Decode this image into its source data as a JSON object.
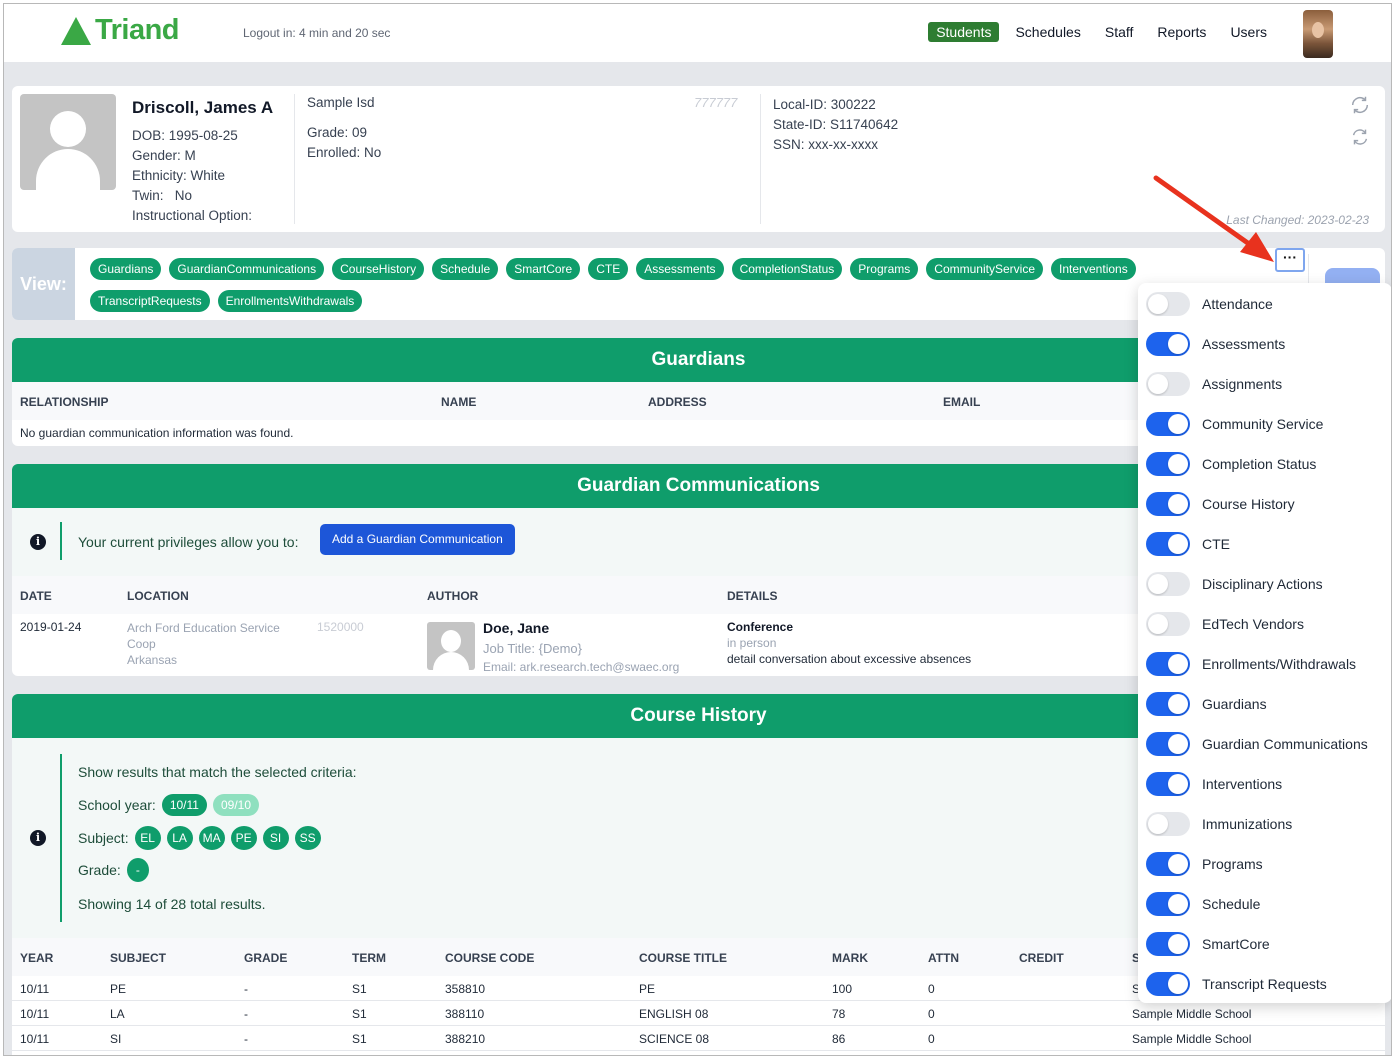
{
  "header": {
    "logo_text": "Triand",
    "logout_text": "Logout in: 4 min and 20 sec",
    "nav": [
      {
        "label": "Students",
        "active": true
      },
      {
        "label": "Schedules",
        "active": false
      },
      {
        "label": "Staff",
        "active": false
      },
      {
        "label": "Reports",
        "active": false
      },
      {
        "label": "Users",
        "active": false
      }
    ]
  },
  "student": {
    "name": "Driscoll, James A",
    "dob": "DOB: 1995-08-25",
    "gender": "Gender: M",
    "ethnicity": "Ethnicity: White",
    "twin": "Twin:   No",
    "instructional_option": "Instructional Option:",
    "district": "Sample Isd",
    "district_code": "777777",
    "grade": "Grade: 09",
    "enrolled": "Enrolled: No",
    "local_id": "Local-ID: 300222",
    "state_id": "State-ID: S11740642",
    "ssn": "SSN: xxx-xx-xxxx",
    "last_changed": "Last Changed: 2023-02-23"
  },
  "view": {
    "label": "View:",
    "pills": [
      "Guardians",
      "GuardianCommunications",
      "CourseHistory",
      "Schedule",
      "SmartCore",
      "CTE",
      "Assessments",
      "CompletionStatus",
      "Programs",
      "CommunityService",
      "Interventions",
      "TranscriptRequests",
      "EnrollmentsWithdrawals"
    ],
    "more_label": "···"
  },
  "guardians": {
    "title": "Guardians",
    "columns": [
      "RELATIONSHIP",
      "NAME",
      "ADDRESS",
      "EMAIL"
    ],
    "empty_message": "No guardian communication information was found."
  },
  "guardian_comms": {
    "title": "Guardian Communications",
    "privileges_text": "Your current privileges allow you to:",
    "add_button": "Add a Guardian Communication",
    "columns": [
      "DATE",
      "LOCATION",
      "AUTHOR",
      "DETAILS"
    ],
    "rows": [
      {
        "date": "2019-01-24",
        "location": "Arch Ford Education Service Coop",
        "location_state": "Arkansas",
        "location_code": "1520000",
        "author_name": "Doe, Jane",
        "author_job": "Job Title: {Demo}",
        "author_email": "Email: ark.research.tech@swaec.org",
        "detail_type": "Conference",
        "detail_mode": "in person",
        "detail_text": "detail conversation about excessive absences"
      }
    ]
  },
  "course_history": {
    "title": "Course History",
    "criteria_title": "Show results that match the selected criteria:",
    "school_year_label": "School year:",
    "school_years": [
      {
        "label": "10/11",
        "selected": true
      },
      {
        "label": "09/10",
        "selected": false
      }
    ],
    "subject_label": "Subject:",
    "subjects": [
      "EL",
      "LA",
      "MA",
      "PE",
      "SI",
      "SS"
    ],
    "grade_label": "Grade:",
    "grades": [
      "-"
    ],
    "showing_text": "Showing 14 of 28 total results.",
    "columns": [
      "YEAR",
      "SUBJECT",
      "GRADE",
      "TERM",
      "COURSE CODE",
      "COURSE TITLE",
      "MARK",
      "ATTN",
      "CREDIT",
      "SCHOOL"
    ],
    "rows": [
      {
        "year": "10/11",
        "subject": "PE",
        "grade": "-",
        "term": "S1",
        "code": "358810",
        "title": "PE",
        "mark": "100",
        "attn": "0",
        "credit": "",
        "school": "Sample Middle School"
      },
      {
        "year": "10/11",
        "subject": "LA",
        "grade": "-",
        "term": "S1",
        "code": "388110",
        "title": "ENGLISH 08",
        "mark": "78",
        "attn": "0",
        "credit": "",
        "school": "Sample Middle School"
      },
      {
        "year": "10/11",
        "subject": "SI",
        "grade": "-",
        "term": "S1",
        "code": "388210",
        "title": "SCIENCE 08",
        "mark": "86",
        "attn": "0",
        "credit": "",
        "school": "Sample Middle School"
      }
    ]
  },
  "view_toggles": [
    {
      "label": "Attendance",
      "on": false
    },
    {
      "label": "Assessments",
      "on": true
    },
    {
      "label": "Assignments",
      "on": false
    },
    {
      "label": "Community Service",
      "on": true
    },
    {
      "label": "Completion Status",
      "on": true
    },
    {
      "label": "Course History",
      "on": true
    },
    {
      "label": "CTE",
      "on": true
    },
    {
      "label": "Disciplinary Actions",
      "on": false
    },
    {
      "label": "EdTech Vendors",
      "on": false
    },
    {
      "label": "Enrollments/Withdrawals",
      "on": true
    },
    {
      "label": "Guardians",
      "on": true
    },
    {
      "label": "Guardian Communications",
      "on": true
    },
    {
      "label": "Interventions",
      "on": true
    },
    {
      "label": "Immunizations",
      "on": false
    },
    {
      "label": "Programs",
      "on": true
    },
    {
      "label": "Schedule",
      "on": true
    },
    {
      "label": "SmartCore",
      "on": true
    },
    {
      "label": "Transcript Requests",
      "on": true
    }
  ],
  "colors": {
    "brand_green": "#3aa845",
    "section_green": "#0f9d6b",
    "nav_active": "#2e7d32",
    "toggle_on": "#1d63ed",
    "primary_button": "#1d56d8",
    "annotation_arrow": "#e8321e"
  }
}
